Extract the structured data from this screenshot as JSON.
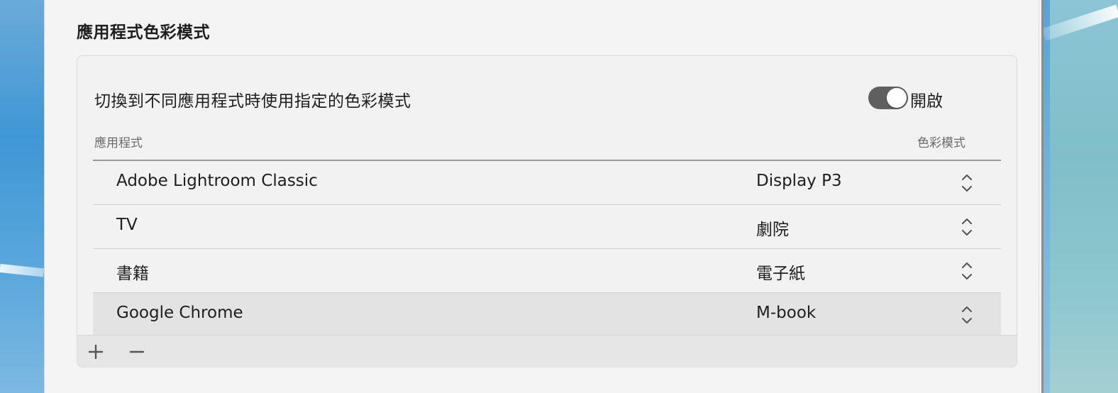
{
  "section": {
    "title": "應用程式色彩模式"
  },
  "switch": {
    "label": "切換到不同應用程式時使用指定的色彩模式",
    "state_label": "開啟",
    "on": true
  },
  "table": {
    "headers": {
      "app": "應用程式",
      "mode": "色彩模式"
    },
    "rows": [
      {
        "app": "Adobe Lightroom Classic",
        "mode": "Display P3",
        "selected": false
      },
      {
        "app": "TV",
        "mode": "劇院",
        "selected": false
      },
      {
        "app": "書籍",
        "mode": "電子紙",
        "selected": false
      },
      {
        "app": "Google Chrome",
        "mode": "M-book",
        "selected": true
      }
    ]
  },
  "toolbar": {
    "add_icon": "plus-icon",
    "remove_icon": "minus-icon"
  },
  "colors": {
    "toggle_on": "#5f5f5f",
    "selected_row": "#e3e3e3"
  }
}
